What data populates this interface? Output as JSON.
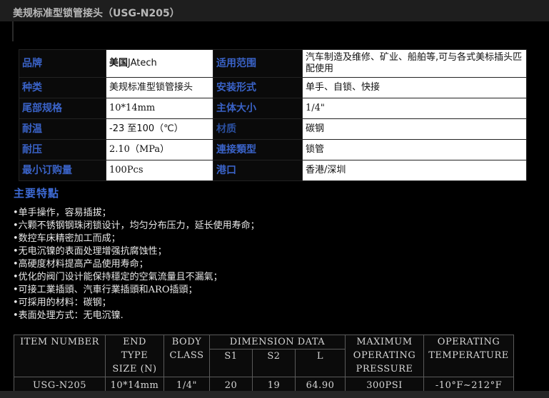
{
  "page": {
    "title": "美规标准型锁管接头（USG-N205）"
  },
  "spec": {
    "brand_label": "品牌",
    "brand_value_prefix": "美国",
    "brand_value": "JAtech",
    "range_label": "适用范围",
    "range_value": "汽车制造及维修、矿业、船舶等,可与各式美标插头匹配使用",
    "type_label": "种类",
    "type_value": "美规标准型锁管接头",
    "mount_label": "安装形式",
    "mount_value": "单手、自锁、快接",
    "tail_label": "尾部规格",
    "tail_value": "10*14mm",
    "body_label": "主体大小",
    "body_value": "1/4\"",
    "temp_label": "耐温",
    "temp_value": "-23 至100（℃）",
    "material_label": "材质",
    "material_value": "碳钢",
    "pressure_label": "耐压",
    "pressure_value": "2.10（MPa）",
    "conn_label": "連接類型",
    "conn_value": "锁管",
    "moq_label": "最小订购量",
    "moq_value": "100Pcs",
    "port_label": "港口",
    "port_value": "香港/深圳"
  },
  "features": {
    "heading": "主要特點",
    "items": [
      "•单手操作，容易插拔；",
      "•六颗不锈钢钢珠闭锁设计，均匀分布压力，延长使用寿命；",
      "•数控车床精密加工而成；",
      "•无电沉镍的表面处理增强抗腐蚀性；",
      "•高硬度材料提高产品使用寿命；",
      "•优化的阀门设计能保持穩定的空氣流量且不漏氣；",
      "•可接工業插頭、汽車行業插頭和ARO插頭；",
      "•可採用的材料：碳钢；",
      "•表面处理方式：无电沉镍."
    ]
  },
  "dims": {
    "headers": {
      "item_number": "ITEM NUMBER",
      "end_type_1": "END",
      "end_type_2": "TYPE",
      "end_type_3": "SIZE (N)",
      "body_1": "BODY",
      "body_2": "CLASS",
      "dimension": "DIMENSION DATA",
      "s1": "S1",
      "s2": "S2",
      "l": "L",
      "max_1": "MAXIMUM",
      "max_2": "OPERATING",
      "max_3": "PRESSURE",
      "optemp_1": "OPERATING",
      "optemp_2": "TEMPERATURE"
    },
    "row": {
      "item_number": "USG-N205",
      "end_type": "10*14mm",
      "body_class": "1/4\"",
      "s1": "20",
      "s2": "19",
      "l": "64.90",
      "max_pressure": "300PSI",
      "op_temp": "-10°F~212°F"
    }
  }
}
